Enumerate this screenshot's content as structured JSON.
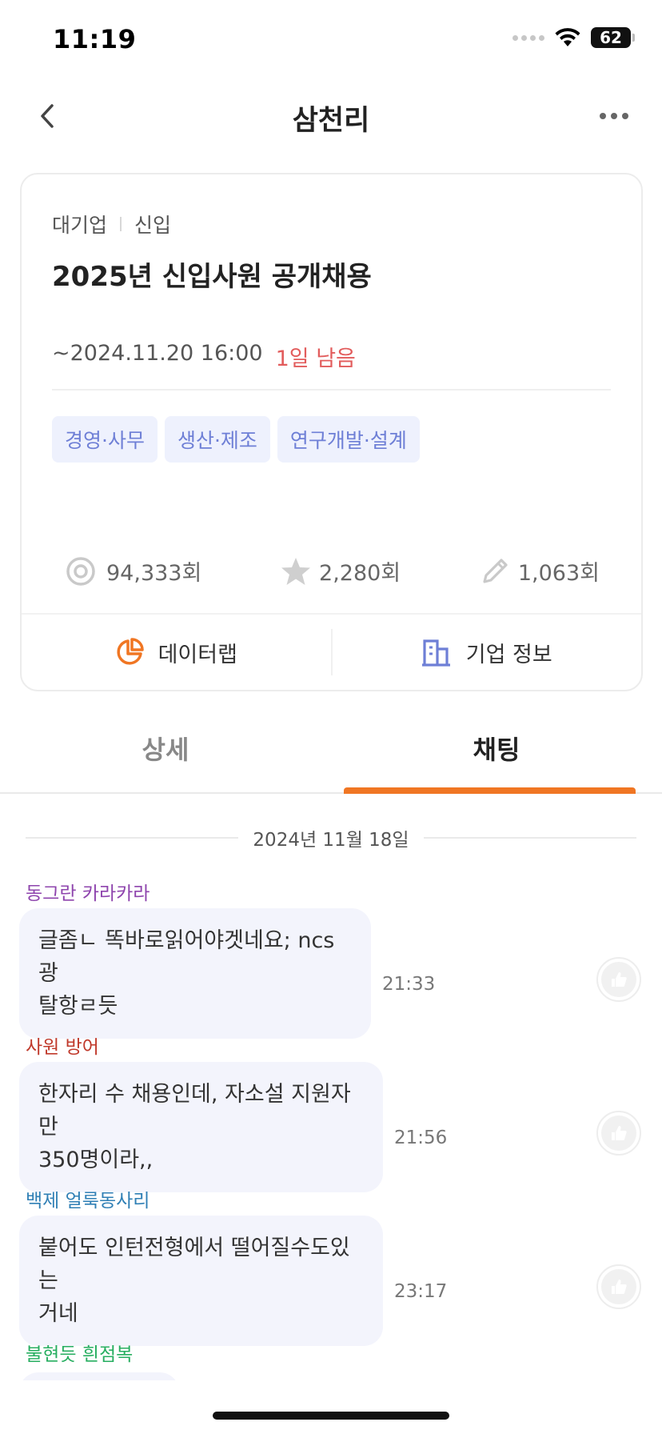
{
  "status_bar": {
    "time": "11:19",
    "battery": "62"
  },
  "nav": {
    "title": "삼천리"
  },
  "job": {
    "company_type": "대기업",
    "career": "신입",
    "title": "2025년 신입사원 공개채용",
    "deadline": "~2024.11.20 16:00",
    "remaining": "1일 남음",
    "tags": [
      "경영·사무",
      "생산·제조",
      "연구개발·설계"
    ],
    "stats": {
      "views": "94,333회",
      "scraps": "2,280회",
      "applies": "1,063회"
    },
    "footer": {
      "datalab": "데이터랩",
      "company_info": "기업 정보"
    }
  },
  "tabs": {
    "detail": "상세",
    "chat": "채팅",
    "active": "채팅"
  },
  "chat": {
    "date": "2024년 11월 18일",
    "messages": [
      {
        "author": "동그란 카라카라",
        "author_color": "#8e44ad",
        "line1": "글좀ㄴ 똑바로읽어야겟네요; ncs 광",
        "line2": "탈항ㄹ듯",
        "time": "21:33"
      },
      {
        "author": "사원 방어",
        "author_color": "#c0392b",
        "line1": "한자리 수 채용인데, 자소설 지원자만",
        "line2": "350명이라,,",
        "time": "21:56"
      },
      {
        "author": "백제 얼룩동사리",
        "author_color": "#2f7fb5",
        "line1": "붙어도 인턴전형에서 떨어질수도있는",
        "line2": "거네",
        "time": "23:17"
      },
      {
        "author": "불현듯 흰점복",
        "author_color": "#27ae60"
      }
    ]
  },
  "colors": {
    "accent": "#f07623",
    "tag_text": "#6e7fd6",
    "tag_bg": "#eef1fd",
    "remaining": "#e25c5c",
    "bubble": "#f3f4fc"
  }
}
